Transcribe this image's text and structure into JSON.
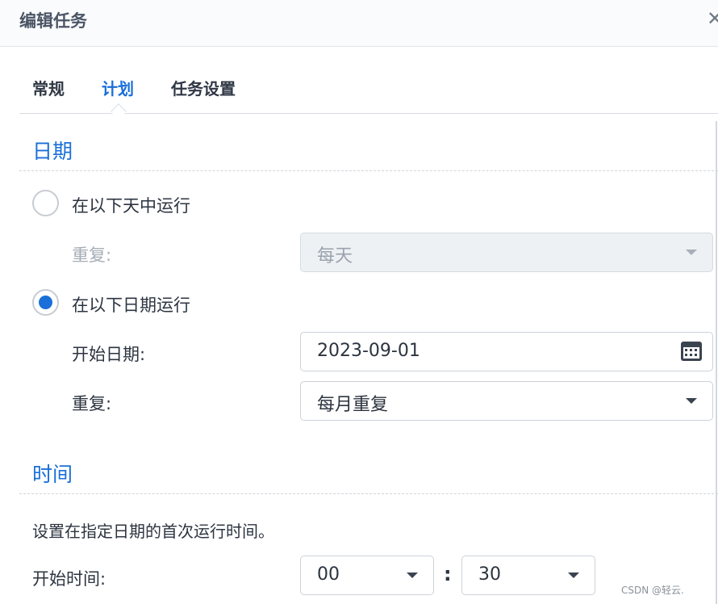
{
  "window": {
    "title": "编辑任务",
    "close_label": "✕"
  },
  "tabs": [
    {
      "label": "常规",
      "active": false
    },
    {
      "label": "计划",
      "active": true
    },
    {
      "label": "任务设置",
      "active": false
    }
  ],
  "date_section": {
    "title": "日期",
    "option_daily": {
      "label": "在以下天中运行",
      "selected": false
    },
    "repeat_daily": {
      "label": "重复:",
      "value": "每天",
      "disabled": true
    },
    "option_date": {
      "label": "在以下日期运行",
      "selected": true
    },
    "start_date": {
      "label": "开始日期:",
      "value": "2023-09-01"
    },
    "repeat_date": {
      "label": "重复:",
      "value": "每月重复"
    }
  },
  "time_section": {
    "title": "时间",
    "description": "设置在指定日期的首次运行时间。",
    "start_time_label": "开始时间:",
    "hour": "00",
    "separator": ":",
    "minute": "30"
  },
  "watermark": "CSDN @轻云.",
  "colors": {
    "accent": "#1a6fd9",
    "text": "#2c3440",
    "border": "#cdd2d8",
    "disabled_bg": "#eef1f4"
  }
}
